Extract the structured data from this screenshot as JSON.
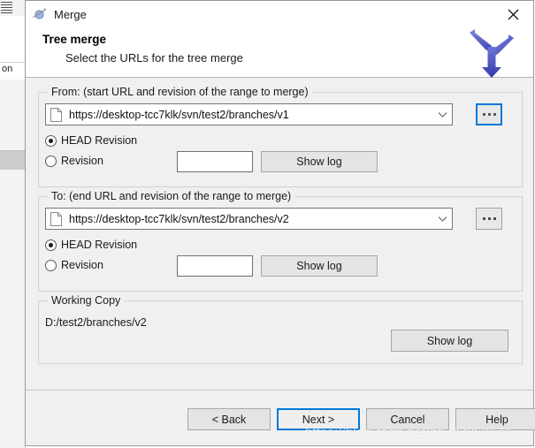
{
  "window": {
    "title": "Merge",
    "title_icon": "merge-planet-icon",
    "close_label": "✕"
  },
  "header": {
    "title": "Tree merge",
    "subtitle": "Select the URLs for the tree merge",
    "icon": "merge-arrows-icon"
  },
  "from_group": {
    "legend": "From: (start URL and revision of the range to merge)",
    "url": "https://desktop-tcc7klk/svn/test2/branches/v1",
    "url_icon": "document-icon",
    "dropdown_icon": "chevron-down-icon",
    "browse_label": "...",
    "head_radio_label": "HEAD Revision",
    "head_radio_checked": true,
    "revision_radio_label": "Revision",
    "revision_radio_checked": false,
    "revision_value": "",
    "show_log_label": "Show log"
  },
  "to_group": {
    "legend": "To: (end URL and revision of the range to merge)",
    "url": "https://desktop-tcc7klk/svn/test2/branches/v2",
    "url_icon": "document-icon",
    "dropdown_icon": "chevron-down-icon",
    "browse_label": "...",
    "head_radio_label": "HEAD Revision",
    "head_radio_checked": true,
    "revision_radio_label": "Revision",
    "revision_radio_checked": false,
    "revision_value": "",
    "show_log_label": "Show log"
  },
  "working_copy": {
    "legend": "Working Copy",
    "path": "D:/test2/branches/v2",
    "show_log_label": "Show log"
  },
  "footer": {
    "back_label": "< Back",
    "next_label": "Next >",
    "cancel_label": "Cancel",
    "help_label": "Help"
  },
  "watermark": {
    "text": "https://blog.csdn.net/qq_33053671"
  },
  "background": {
    "row_text": "on"
  },
  "colors": {
    "accent": "#0078d7",
    "dialog_bg": "#f0f0f0",
    "header_bg": "#ffffff",
    "border": "#9a9a9a",
    "merge_arrow": "#4a51c4"
  }
}
